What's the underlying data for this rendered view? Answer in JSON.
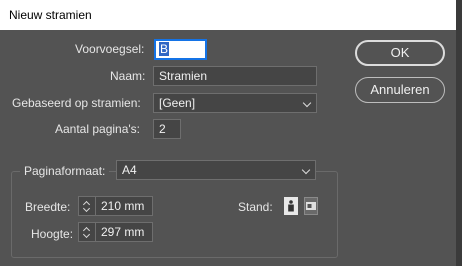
{
  "dialog": {
    "title": "Nieuw stramien"
  },
  "form": {
    "prefix_label": "Voorvoegsel:",
    "prefix_value": "B",
    "name_label": "Naam:",
    "name_value": "Stramien",
    "based_on_label": "Gebaseerd op stramien:",
    "based_on_value": "[Geen]",
    "pages_label": "Aantal pagina's:",
    "pages_value": "2"
  },
  "page_size": {
    "label": "Paginaformaat:",
    "value": "A4",
    "width_label": "Breedte:",
    "width_value": "210 mm",
    "height_label": "Hoogte:",
    "height_value": "297 mm",
    "orientation_label": "Stand:",
    "orientation_selected": "portrait"
  },
  "buttons": {
    "ok": "OK",
    "cancel": "Annuleren"
  },
  "icons": {
    "portrait": "portrait-orientation-icon",
    "landscape": "landscape-orientation-icon"
  }
}
